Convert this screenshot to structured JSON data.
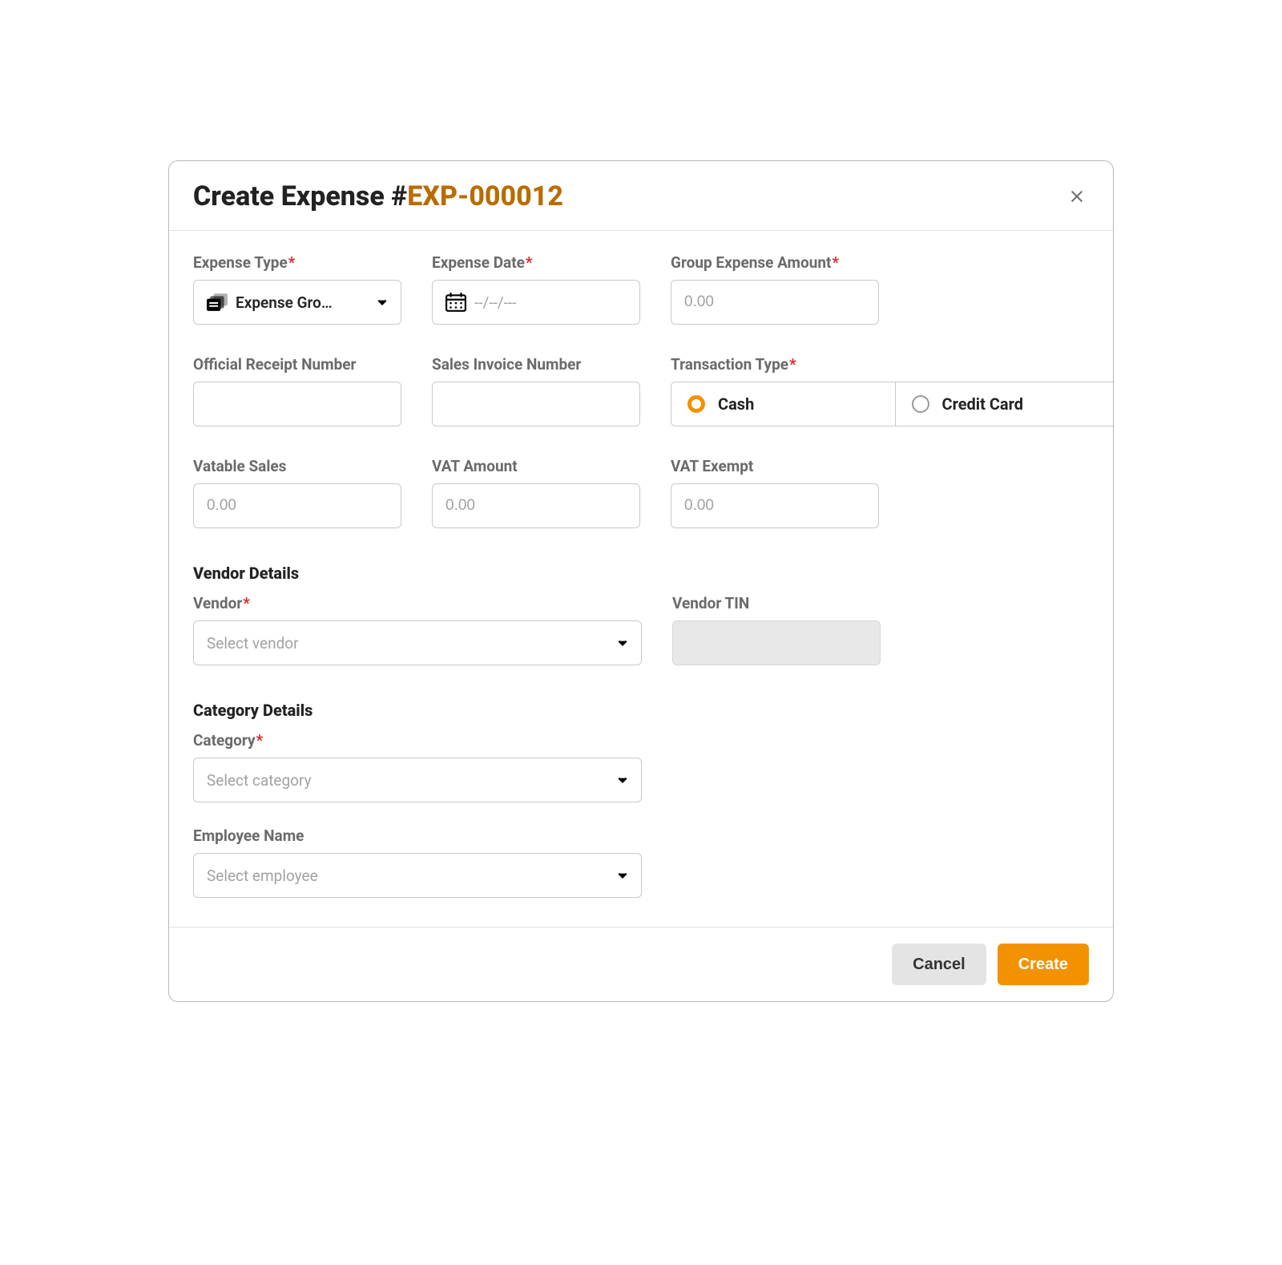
{
  "modal": {
    "title_prefix": "Create Expense #",
    "title_id": "EXP-000012"
  },
  "fields": {
    "expense_type": {
      "label": "Expense Type",
      "required": true,
      "value": "Expense Gro…"
    },
    "expense_date": {
      "label": "Expense Date",
      "required": true,
      "placeholder": "--/--/---"
    },
    "group_amount": {
      "label": "Group Expense Amount",
      "required": true,
      "placeholder": "0.00"
    },
    "or_number": {
      "label": "Official Receipt Number",
      "required": false
    },
    "si_number": {
      "label": "Sales Invoice Number",
      "required": false
    },
    "trans_type": {
      "label": "Transaction Type",
      "required": true,
      "options": [
        "Cash",
        "Credit Card"
      ],
      "selected": "Cash"
    },
    "vatable": {
      "label": "Vatable Sales",
      "placeholder": "0.00"
    },
    "vat_amount": {
      "label": "VAT Amount",
      "placeholder": "0.00"
    },
    "vat_exempt": {
      "label": "VAT Exempt",
      "placeholder": "0.00"
    }
  },
  "vendor_section": {
    "title": "Vendor Details",
    "vendor": {
      "label": "Vendor",
      "required": true,
      "placeholder": "Select vendor"
    },
    "vendor_tin": {
      "label": "Vendor TIN"
    }
  },
  "category_section": {
    "title": "Category Details",
    "category": {
      "label": "Category",
      "required": true,
      "placeholder": "Select category"
    },
    "employee": {
      "label": "Employee Name",
      "placeholder": "Select employee"
    }
  },
  "footer": {
    "cancel": "Cancel",
    "create": "Create"
  },
  "colors": {
    "accent": "#f39200",
    "title_id": "#b96d00",
    "required": "#e02626"
  }
}
